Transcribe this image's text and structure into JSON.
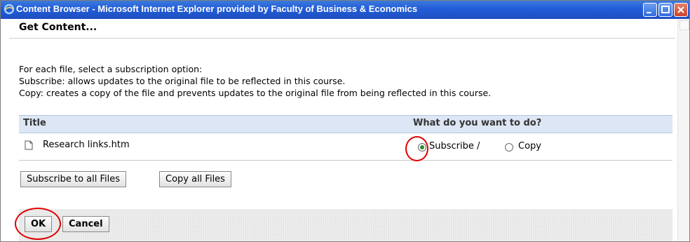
{
  "window": {
    "title": "Content Browser - Microsoft Internet Explorer provided by Faculty of Business & Economics",
    "icon": "ie-icon"
  },
  "page": {
    "heading": "Get Content...",
    "instructions": [
      "For each file, select a subscription option:",
      "Subscribe: allows updates to the original file to be reflected in this course.",
      "Copy: creates a copy of the file and prevents updates to the original file from being reflected in this course."
    ]
  },
  "table": {
    "headers": [
      "Title",
      "What do you want to do?"
    ],
    "rows": [
      {
        "file_name": "Research links.htm",
        "option_subscribe": "Subscribe /",
        "option_copy": "Copy",
        "selected": "subscribe"
      }
    ]
  },
  "actions": {
    "subscribe_all": "Subscribe to all Files",
    "copy_all": "Copy all Files"
  },
  "footer": {
    "ok": "OK",
    "cancel": "Cancel"
  },
  "colors": {
    "titlebar": "#245edb",
    "header_bg": "#dde6f4",
    "annotation": "#e00000"
  }
}
